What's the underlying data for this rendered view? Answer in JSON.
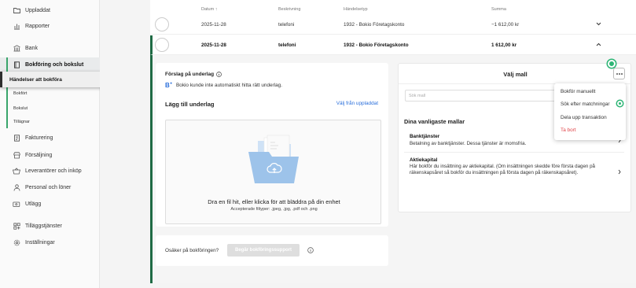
{
  "sidebar": {
    "items": [
      {
        "label": "Uppladdat",
        "icon": "folder-icon"
      },
      {
        "label": "Rapporter",
        "icon": "bar-chart-icon"
      },
      {
        "label": "Bank",
        "icon": "bank-icon"
      },
      {
        "label": "Bokföring och bokslut",
        "icon": "book-icon"
      },
      {
        "label": "Fakturering",
        "icon": "invoice-icon"
      },
      {
        "label": "Försäljning",
        "icon": "store-icon"
      },
      {
        "label": "Leverantörer och inköp",
        "icon": "basket-icon"
      },
      {
        "label": "Personal och löner",
        "icon": "person-icon"
      },
      {
        "label": "Utlägg",
        "icon": "receipt-icon"
      },
      {
        "label": "Tilläggstjänster",
        "icon": "apps-icon"
      },
      {
        "label": "Inställningar",
        "icon": "gear-icon"
      }
    ],
    "subitems": [
      "Bokfört",
      "Bokslut",
      "Tillägnar"
    ],
    "tooltip": "Händelser att bokföra"
  },
  "table": {
    "headers": {
      "date": "Datum",
      "sort_arrow": "↑",
      "description": "Beskrivning",
      "event_type": "Händelsetyp",
      "amount": "Summa"
    },
    "rows": [
      {
        "date": "2025-11-28",
        "description": "telefoni",
        "event_type": "1932 - Bokio Företagskonto",
        "amount": "−1 612,00 kr"
      },
      {
        "date": "2025-11-28",
        "description": "telefoni",
        "event_type": "1932 - Bokio Företagskonto",
        "amount": "1 612,00 kr"
      }
    ]
  },
  "underlag": {
    "suggestion_title": "Förslag på underlag",
    "info_text": "Bokio kunde inte automatiskt hitta rätt underlag.",
    "add_title": "Lägg till underlag",
    "choose_link": "Välj från uppladdat",
    "drop_text": "Dra en fil hit, eller klicka för att bläddra på din enhet",
    "accepted": "Accepterade filtyper: .jpeg, .jpg, .pdf och .png"
  },
  "support": {
    "question": "Osäker på bokföringen?",
    "button": "Begär bokföringssupport"
  },
  "template_panel": {
    "title": "Välj mall",
    "search_placeholder": "Sök mall",
    "common_title": "Dina vanligaste mallar",
    "templates": [
      {
        "name": "Banktjänster",
        "desc": "Betalning av banktjänster. Dessa tjänster är momsfria."
      },
      {
        "name": "Aktiekapital",
        "desc": "Här bokför du insättning av aktiekapital. (Om insättningen skedde före första dagen på räkenskapsåret så bokför du insättningen på första dagen på räkenskapsåret)."
      }
    ]
  },
  "menu": {
    "items": [
      "Bokför manuellt",
      "Sök efter matchningar",
      "Dela upp transaktion",
      "Ta bort"
    ]
  },
  "colors": {
    "accent": "#2db575",
    "danger": "#e0454a",
    "link": "#2a6fdb",
    "dark_green": "#1f6b45"
  }
}
